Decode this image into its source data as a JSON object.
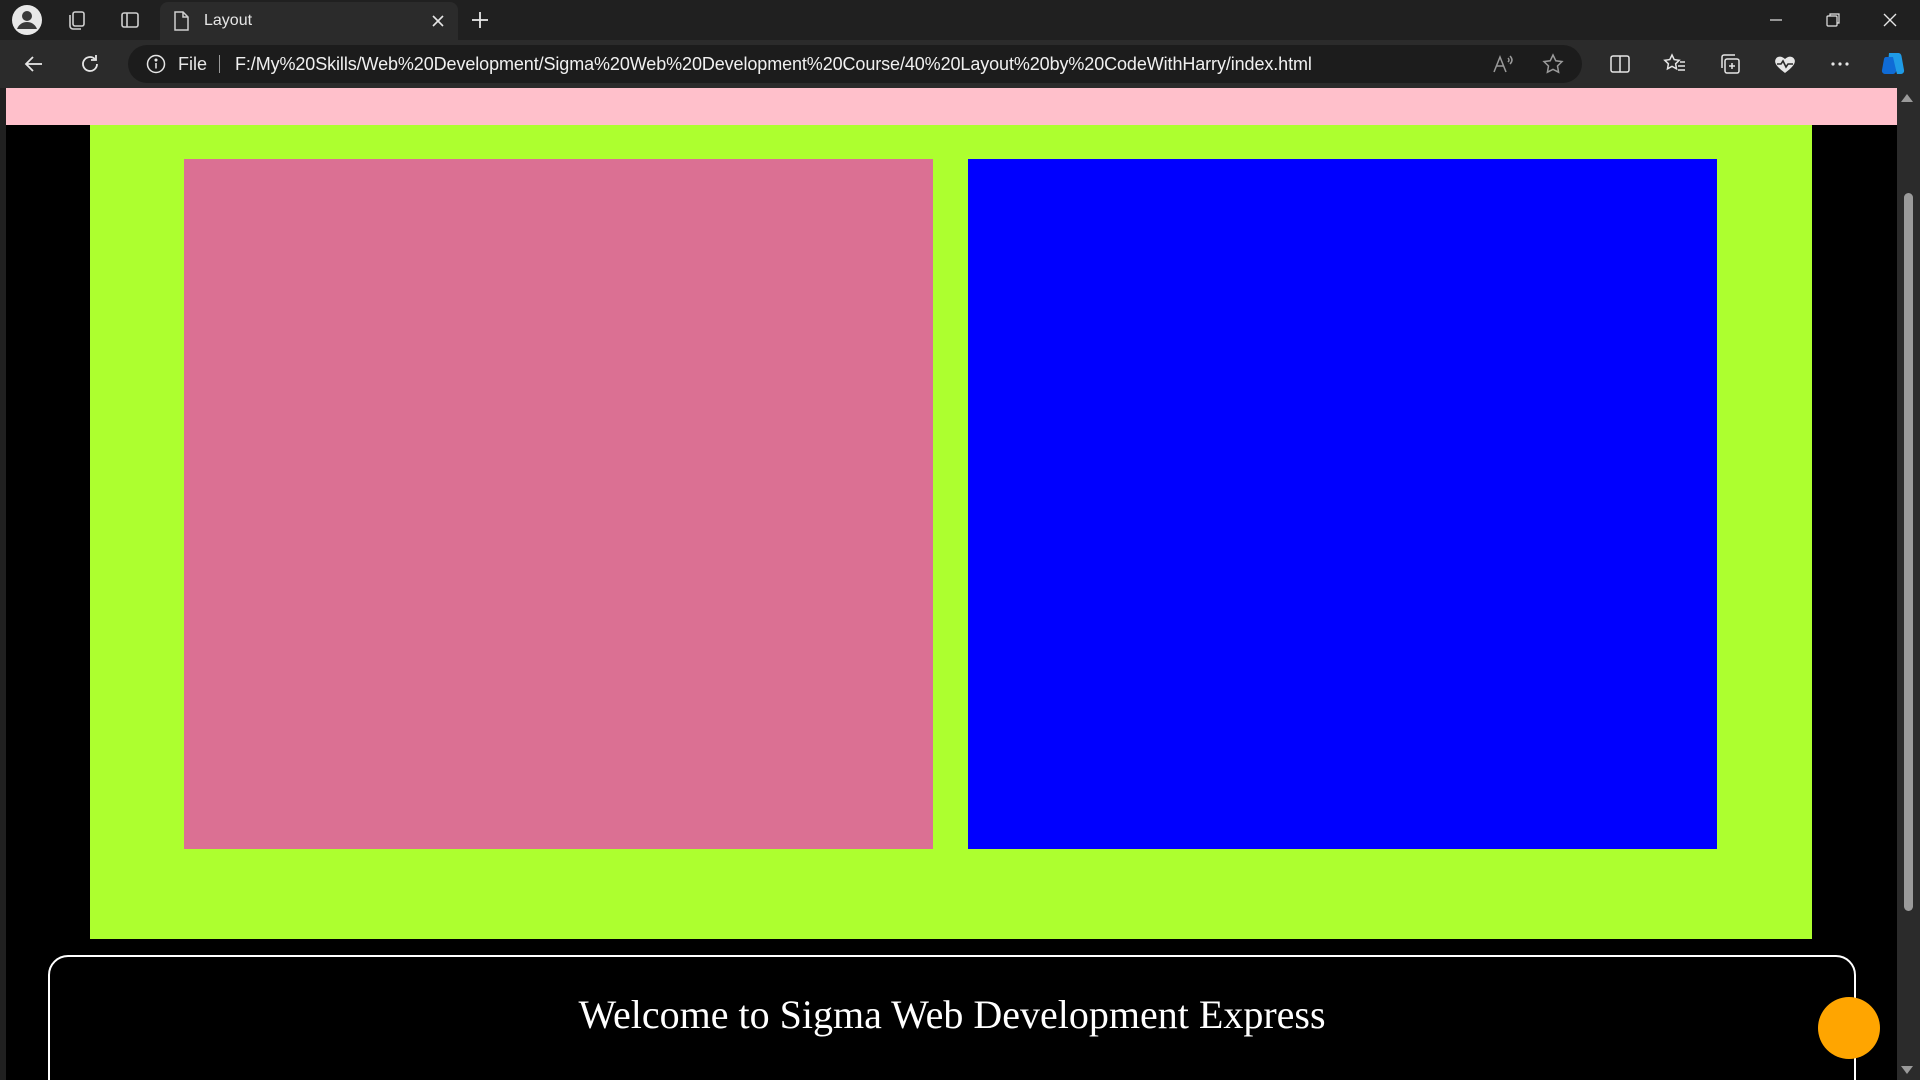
{
  "browser": {
    "tab_title": "Layout",
    "address_scheme_label": "File",
    "url": "F:/My%20Skills/Web%20Development/Sigma%20Web%20Development%20Course/40%20Layout%20by%20CodeWithHarry/index.html",
    "icons": {
      "profile": "profile-icon",
      "workspaces": "workspaces-icon",
      "tab_actions": "tab-actions-icon",
      "tab_doc": "document-icon",
      "tab_close": "close-icon",
      "new_tab": "plus-icon",
      "back": "back-arrow-icon",
      "refresh": "refresh-icon",
      "info": "info-icon",
      "read_aloud": "read-aloud-icon",
      "favorite": "star-icon",
      "split_screen": "split-screen-icon",
      "favorites": "favorites-icon",
      "collections": "collections-icon",
      "browser_essentials": "heart-pulse-icon",
      "more": "more-icon",
      "copilot": "copilot-icon",
      "minimize": "minimize-icon",
      "restore": "restore-icon",
      "close_window": "close-window-icon"
    }
  },
  "page": {
    "banner_text": "Welcome to Sigma Web Development Express",
    "colors": {
      "body_background": "#000000",
      "top_bar": "#ffc0cb",
      "container": "#adff2f",
      "left_box": "#db7093",
      "right_box": "#0000ff",
      "circle": "#ffa500",
      "banner_border": "#ffffff",
      "banner_text": "#ffffff"
    }
  }
}
